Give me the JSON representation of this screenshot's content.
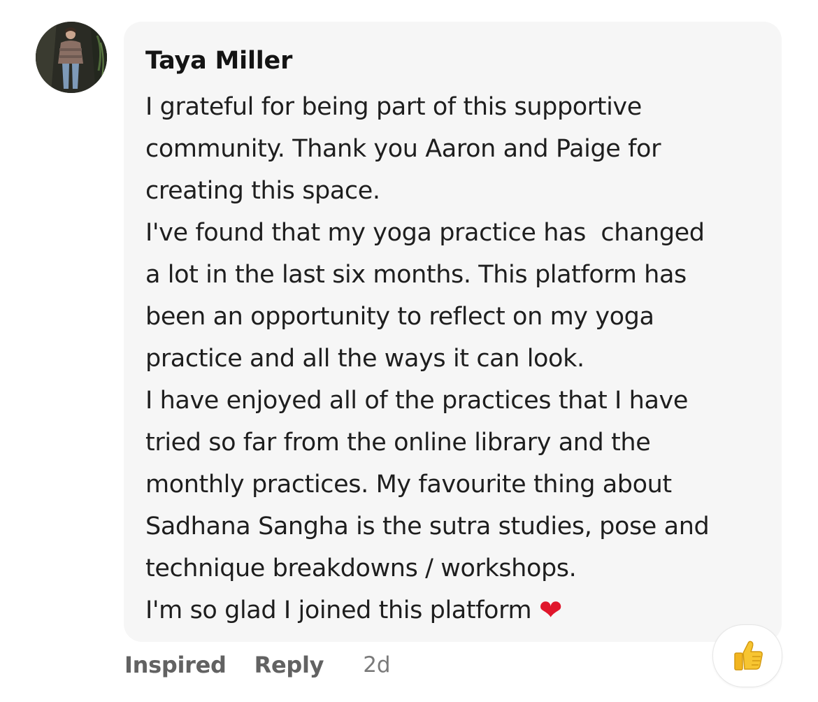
{
  "comment": {
    "author": "Taya Miller",
    "lines": [
      "I grateful for being part of this supportive",
      "community. Thank you Aaron and Paige for",
      "creating this space.",
      "I've found that my yoga practice has  changed",
      "a lot in the last six months. This platform has",
      "been an opportunity to reflect on my yoga",
      "practice and all the ways it can look.",
      "I have enjoyed all of the practices that I have",
      "tried so far from the online library and the",
      "monthly practices. My favourite thing about",
      "Sadhana Sangha is the sutra studies, pose and",
      "technique breakdowns / workshops.",
      "I'm so glad I joined this platform "
    ],
    "heart_emoji": "❤",
    "actions": {
      "inspired": "Inspired",
      "reply": "Reply",
      "timestamp": "2d"
    },
    "reaction_icon": "thumbs-up-icon"
  }
}
